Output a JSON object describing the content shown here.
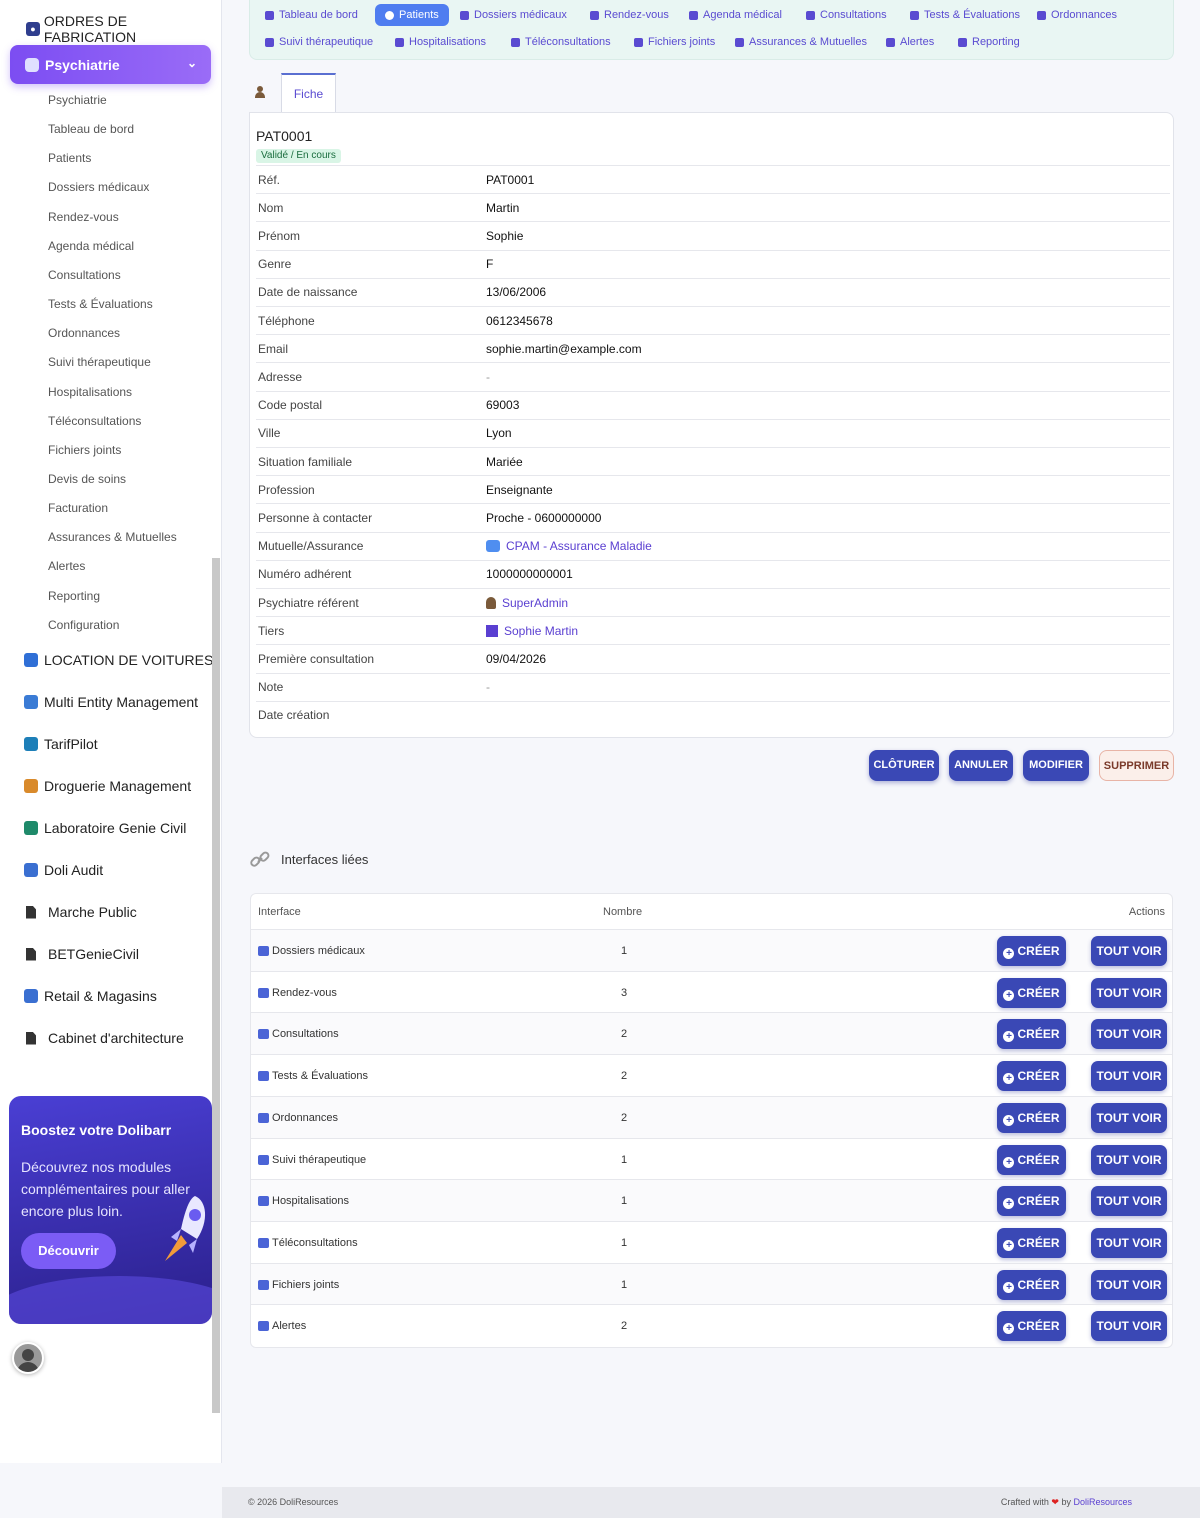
{
  "sidebar": {
    "top_module": "ORDRES DE FABRICATION",
    "active_module": "Psychiatrie",
    "sub_items": [
      "Psychiatrie",
      "Tableau de bord",
      "Patients",
      "Dossiers médicaux",
      "Rendez-vous",
      "Agenda médical",
      "Consultations",
      "Tests & Évaluations",
      "Ordonnances",
      "Suivi thérapeutique",
      "Hospitalisations",
      "Téléconsultations",
      "Fichiers joints",
      "Devis de soins",
      "Facturation",
      "Assurances & Mutuelles",
      "Alertes",
      "Reporting",
      "Configuration"
    ],
    "modules": [
      "LOCATION DE VOITURES",
      "Multi Entity Management",
      "TarifPilot",
      "Droguerie Management",
      "Laboratoire Genie Civil",
      "Doli Audit",
      "Marche Public",
      "BETGenieCivil",
      "Retail & Magasins",
      "Cabinet d'architecture"
    ],
    "promo": {
      "title": "Boostez votre Dolibarr",
      "text": "Découvrez nos modules complémentaires pour aller encore plus loin.",
      "button": "Découvrir"
    }
  },
  "topnav": {
    "row1": [
      "Tableau de bord",
      "Patients",
      "Dossiers médicaux",
      "Rendez-vous",
      "Agenda médical",
      "Consultations",
      "Tests & Évaluations",
      "Ordonnances"
    ],
    "row2": [
      "Suivi thérapeutique",
      "Hospitalisations",
      "Téléconsultations",
      "Fichiers joints",
      "Assurances & Mutuelles",
      "Alertes",
      "Reporting"
    ],
    "active": "Patients"
  },
  "tab": {
    "fiche": "Fiche"
  },
  "record": {
    "ref": "PAT0001",
    "status": "Validé / En cours",
    "fields": [
      {
        "label": "Réf.",
        "value": "PAT0001"
      },
      {
        "label": "Nom",
        "value": "Martin"
      },
      {
        "label": "Prénom",
        "value": "Sophie"
      },
      {
        "label": "Genre",
        "value": "F"
      },
      {
        "label": "Date de naissance",
        "value": "13/06/2006"
      },
      {
        "label": "Téléphone",
        "value": "0612345678"
      },
      {
        "label": "Email",
        "value": "sophie.martin@example.com"
      },
      {
        "label": "Adresse",
        "value": "-"
      },
      {
        "label": "Code postal",
        "value": "69003"
      },
      {
        "label": "Ville",
        "value": "Lyon"
      },
      {
        "label": "Situation familiale",
        "value": "Mariée"
      },
      {
        "label": "Profession",
        "value": "Enseignante"
      },
      {
        "label": "Personne à contacter",
        "value": "Proche - 0600000000"
      },
      {
        "label": "Mutuelle/Assurance",
        "value": "CPAM - Assurance Maladie"
      },
      {
        "label": "Numéro adhérent",
        "value": "1000000000001"
      },
      {
        "label": "Psychiatre référent",
        "value": "SuperAdmin"
      },
      {
        "label": "Tiers",
        "value": "Sophie Martin"
      },
      {
        "label": "Première consultation",
        "value": "09/04/2026"
      },
      {
        "label": "Note",
        "value": "-"
      },
      {
        "label": "Date création",
        "value": ""
      }
    ]
  },
  "actions": {
    "close": "CLÔTURER",
    "cancel": "ANNULER",
    "edit": "MODIFIER",
    "delete": "SUPPRIMER"
  },
  "linked": {
    "title": "Interfaces liées",
    "headers": {
      "interface": "Interface",
      "count": "Nombre",
      "actions": "Actions"
    },
    "create_label": "CRÉER",
    "view_label": "TOUT VOIR",
    "rows": [
      {
        "name": "Dossiers médicaux",
        "count": "1"
      },
      {
        "name": "Rendez-vous",
        "count": "3"
      },
      {
        "name": "Consultations",
        "count": "2"
      },
      {
        "name": "Tests & Évaluations",
        "count": "2"
      },
      {
        "name": "Ordonnances",
        "count": "2"
      },
      {
        "name": "Suivi thérapeutique",
        "count": "1"
      },
      {
        "name": "Hospitalisations",
        "count": "1"
      },
      {
        "name": "Téléconsultations",
        "count": "1"
      },
      {
        "name": "Fichiers joints",
        "count": "1"
      },
      {
        "name": "Alertes",
        "count": "2"
      }
    ]
  },
  "footer": {
    "left": "© 2026 DoliResources",
    "crafted": "Crafted with",
    "by": "by",
    "brand": "DoliResources"
  }
}
